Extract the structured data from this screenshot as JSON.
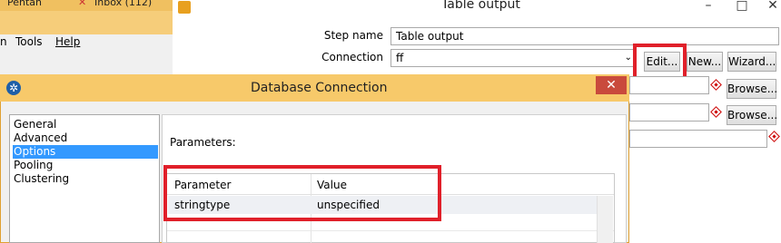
{
  "background_app": {
    "tabs": [
      "Pentah",
      "Inbox (112)"
    ],
    "menu": [
      "n",
      "Tools",
      "Help"
    ]
  },
  "table_output": {
    "title": "Table output",
    "step_name_label": "Step name",
    "step_name_value": "Table output",
    "connection_label": "Connection",
    "connection_value": "ff",
    "buttons": {
      "edit": "Edit...",
      "new": "New...",
      "wizard": "Wizard...",
      "browse": "Browse..."
    }
  },
  "db_dialog": {
    "title": "Database Connection",
    "categories": [
      {
        "label": "General",
        "selected": false
      },
      {
        "label": "Advanced",
        "selected": false
      },
      {
        "label": "Options",
        "selected": true
      },
      {
        "label": "Pooling",
        "selected": false
      },
      {
        "label": "Clustering",
        "selected": false
      }
    ],
    "parameters_label": "Parameters:",
    "table": {
      "headers": [
        "Parameter",
        "Value"
      ],
      "rows": [
        [
          "stringtype",
          "unspecified"
        ]
      ]
    }
  },
  "colors": {
    "highlight_box": "#e0202a",
    "selection": "#3399ff",
    "dialog_title_bar": "#f7c96a",
    "close_button": "#c94a3c"
  },
  "icons": [
    "pentaho-icon",
    "spoon-icon",
    "close-icon",
    "minimize-icon",
    "maximize-icon",
    "dropdown-arrow-icon",
    "variable-diamond-icon"
  ]
}
